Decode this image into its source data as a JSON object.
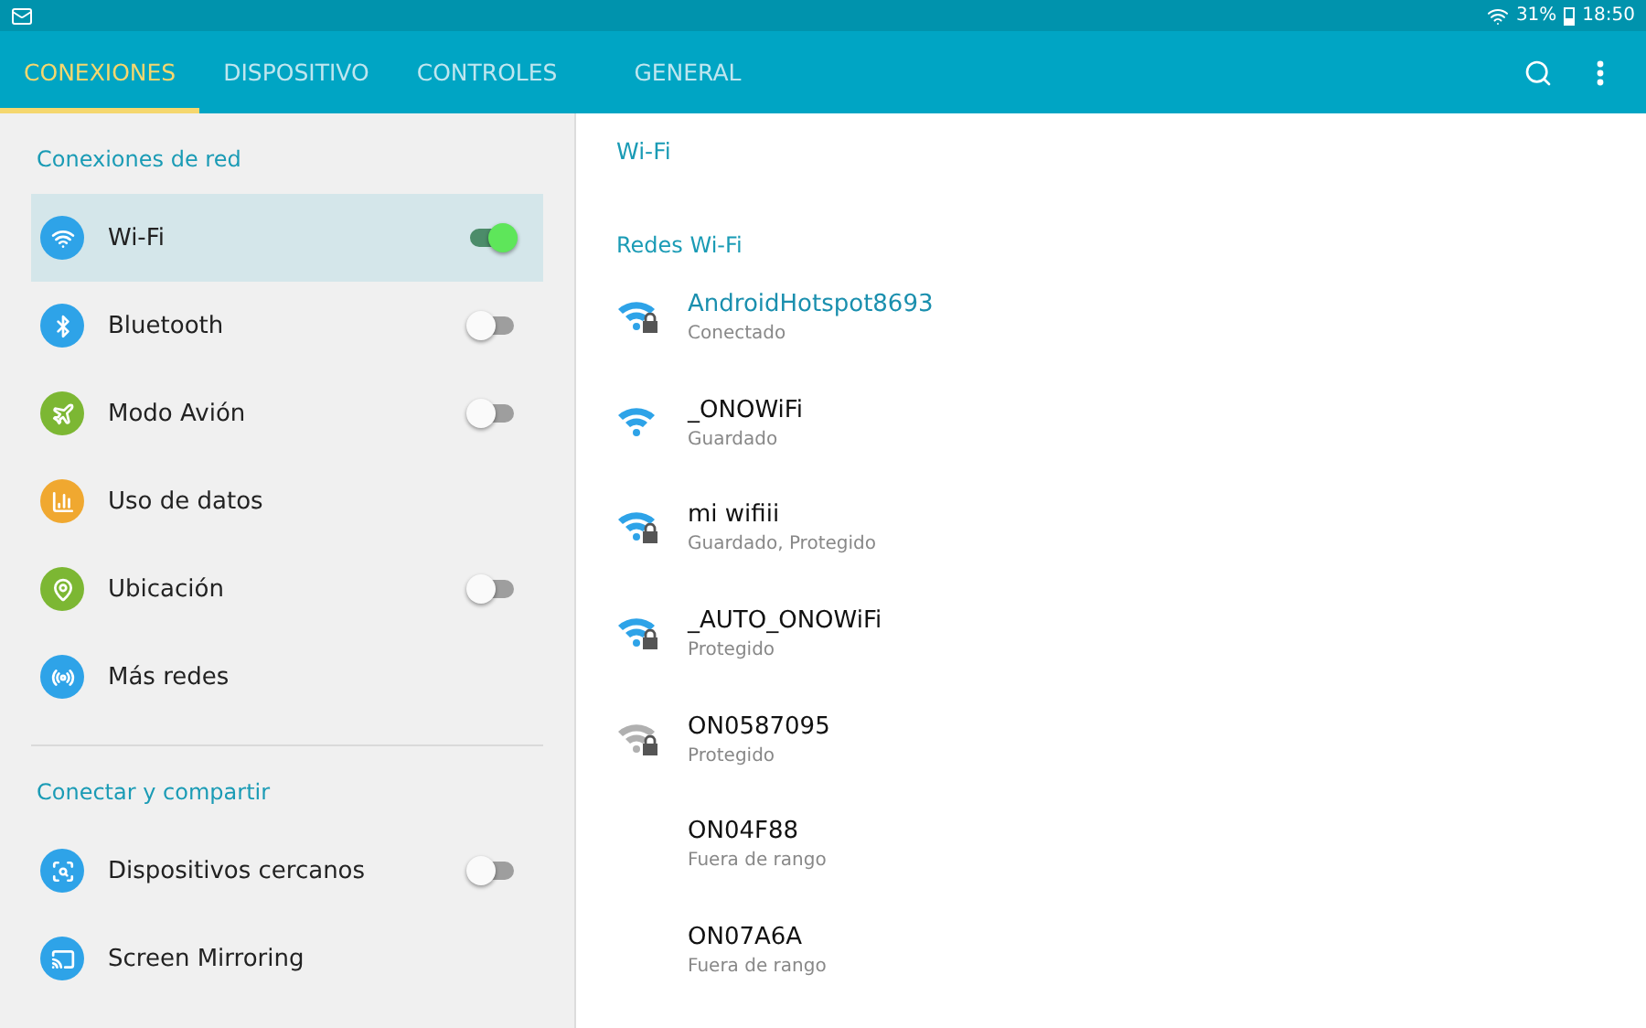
{
  "status_bar": {
    "battery": "31%",
    "time": "18:50"
  },
  "tabs": [
    {
      "label": "CONEXIONES",
      "selected": true
    },
    {
      "label": "DISPOSITIVO",
      "selected": false
    },
    {
      "label": "CONTROLES",
      "selected": false
    },
    {
      "label": "GENERAL",
      "selected": false
    }
  ],
  "sidebar": {
    "sections": [
      {
        "title": "Conexiones de red",
        "items": [
          {
            "label": "Wi-Fi",
            "color": "#2ea3e8",
            "kind": "toggle",
            "on": true,
            "selected": true
          },
          {
            "label": "Bluetooth",
            "color": "#2ea3e8",
            "kind": "toggle",
            "on": false,
            "selected": false
          },
          {
            "label": "Modo Avión",
            "color": "#7cb733",
            "kind": "toggle",
            "on": false,
            "selected": false
          },
          {
            "label": "Uso de datos",
            "color": "#f0a830",
            "kind": "link",
            "selected": false
          },
          {
            "label": "Ubicación",
            "color": "#7cb733",
            "kind": "toggle",
            "on": false,
            "selected": false
          },
          {
            "label": "Más redes",
            "color": "#2ea3e8",
            "kind": "link",
            "selected": false
          }
        ]
      },
      {
        "title": "Conectar y compartir",
        "items": [
          {
            "label": "Dispositivos cercanos",
            "color": "#2ea3e8",
            "kind": "toggle",
            "on": false,
            "selected": false
          },
          {
            "label": "Screen Mirroring",
            "color": "#2ea3e8",
            "kind": "link",
            "selected": false
          }
        ]
      }
    ]
  },
  "content": {
    "title": "Wi-Fi",
    "list_title": "Redes Wi-Fi",
    "networks": [
      {
        "name": "AndroidHotspot8693",
        "status": "Conectado",
        "kind": "strong",
        "secured": true,
        "connected": true
      },
      {
        "name": "_ONOWiFi",
        "status": "Guardado",
        "kind": "strong",
        "secured": false,
        "connected": false
      },
      {
        "name": "mi wifiii",
        "status": "Guardado, Protegido",
        "kind": "strong",
        "secured": true,
        "connected": false
      },
      {
        "name": "_AUTO_ONOWiFi",
        "status": "Protegido",
        "kind": "strong",
        "secured": true,
        "connected": false
      },
      {
        "name": "ON0587095",
        "status": "Protegido",
        "kind": "weak",
        "secured": true,
        "connected": false
      },
      {
        "name": "ON04F88",
        "status": "Fuera de rango",
        "kind": "out_of_range",
        "connected": false
      },
      {
        "name": "ON07A6A",
        "status": "Fuera de rango",
        "kind": "out_of_range",
        "connected": false
      }
    ]
  }
}
